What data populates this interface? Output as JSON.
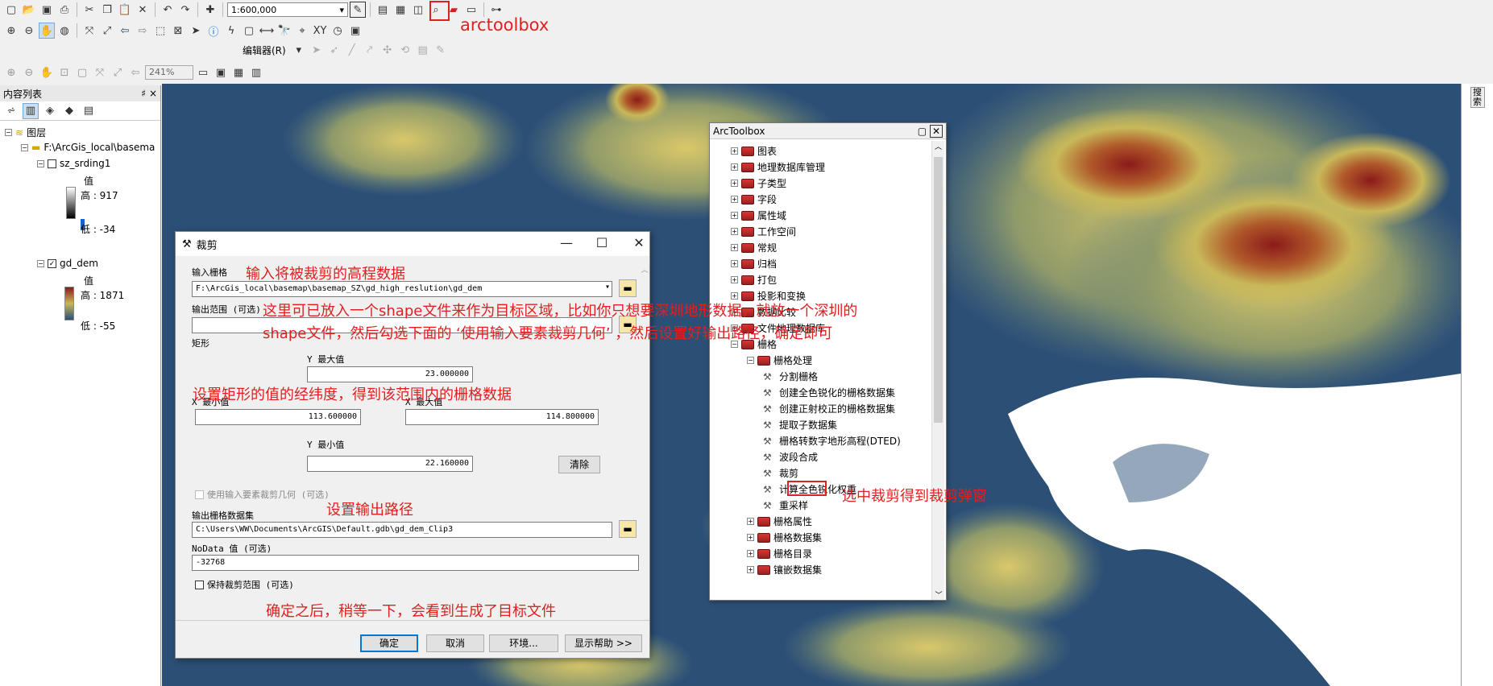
{
  "toolbar": {
    "scale": "1:600,000",
    "zoom": "241%",
    "editor_menu": "编辑器(R)"
  },
  "toc": {
    "title": "内容列表",
    "pin": "♯",
    "close": "×",
    "layers_root": "图层",
    "folder": "F:\\ArcGis_local\\basema",
    "layer1": {
      "name": "sz_srding1",
      "value_label": "值",
      "high": "高 : 917",
      "low": "低 : -34"
    },
    "layer2": {
      "name": "gd_dem",
      "value_label": "值",
      "high": "高 : 1871",
      "low": "低 : -55"
    }
  },
  "right_panel": {
    "label": "搜索"
  },
  "dialog": {
    "title": "裁剪",
    "input_raster_label": "输入栅格",
    "input_raster_value": "F:\\ArcGis_local\\basemap\\basemap_SZ\\gd_high_reslution\\gd_dem",
    "output_extent_label": "输出范围 (可选)",
    "rect_label": "矩形",
    "y_max_label": "Y 最大值",
    "y_max_value": "23.000000",
    "x_min_label": "X 最小值",
    "x_min_value": "113.600000",
    "x_max_label": "X 最大值",
    "x_max_value": "114.800000",
    "y_min_label": "Y 最小值",
    "y_min_value": "22.160000",
    "clear_button": "清除",
    "use_input_features_label": "使用输入要素裁剪几何 (可选)",
    "output_raster_label": "输出栅格数据集",
    "output_raster_value": "C:\\Users\\WW\\Documents\\ArcGIS\\Default.gdb\\gd_dem_Clip3",
    "nodata_label": "NoData 值 (可选)",
    "nodata_value": "-32768",
    "maintain_extent_label": "保持裁剪范围 (可选)",
    "ok": "确定",
    "cancel": "取消",
    "env": "环境...",
    "help": "显示帮助 >>"
  },
  "arctoolbox": {
    "title": "ArcToolbox",
    "items": [
      {
        "label": "图表"
      },
      {
        "label": "地理数据库管理"
      },
      {
        "label": "子类型"
      },
      {
        "label": "字段"
      },
      {
        "label": "属性域"
      },
      {
        "label": "工作空间"
      },
      {
        "label": "常规"
      },
      {
        "label": "归档"
      },
      {
        "label": "打包"
      },
      {
        "label": "投影和变换"
      },
      {
        "label": "数据比较"
      },
      {
        "label": "文件地理数据库"
      },
      {
        "label": "栅格"
      },
      {
        "label": "栅格处理"
      },
      {
        "label": "分割栅格"
      },
      {
        "label": "创建全色锐化的栅格数据集"
      },
      {
        "label": "创建正射校正的栅格数据集"
      },
      {
        "label": "提取子数据集"
      },
      {
        "label": "栅格转数字地形高程(DTED)"
      },
      {
        "label": "波段合成"
      },
      {
        "label": "裁剪"
      },
      {
        "label": "计算全色锐化权重"
      },
      {
        "label": "重采样"
      },
      {
        "label": "栅格属性"
      },
      {
        "label": "栅格数据集"
      },
      {
        "label": "栅格目录"
      },
      {
        "label": "镶嵌数据集"
      }
    ]
  },
  "annotations": {
    "arctoolbox": "arctoolbox",
    "input_dem": "输入将被裁剪的高程数据",
    "shape_line1": "这里可已放入一个shape文件来作为目标区域，比如你只想要深圳地形数据，就放一个深圳的",
    "shape_line2": "shape文件，然后勾选下面的 ‘使用输入要素裁剪几何’ ，然后设置好输出路径，确定即可",
    "rect_note": "设置矩形的值的经纬度，得到该范围内的栅格数据",
    "output_note": "设置输出路径",
    "select_clip": "选中裁剪得到裁剪弹窗",
    "done_note": "确定之后，稍等一下，会看到生成了目标文件"
  },
  "colors": {
    "annotation": "#e02020",
    "map_water": "#2c4f76",
    "map_low": "#c8b85a",
    "map_high": "#8b1a1a"
  }
}
